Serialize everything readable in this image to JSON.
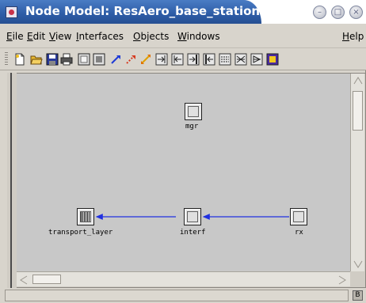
{
  "window": {
    "title": "Node Model: ResAero_base_station",
    "controls": {
      "minimize": "–",
      "maximize": "□",
      "close": "×"
    }
  },
  "menu": {
    "items": [
      {
        "key": "E",
        "rest": "ile"
      },
      {
        "key": "E",
        "rest": "dit"
      },
      {
        "key": "V",
        "rest": "iew"
      },
      {
        "key": "I",
        "rest": "nterfaces"
      },
      {
        "key": "O",
        "rest": "bjects"
      },
      {
        "key": "W",
        "rest": "indows"
      },
      {
        "key": "H",
        "rest": "elp"
      }
    ]
  },
  "toolbar": {
    "icons": [
      "new-file-icon",
      "open-folder-icon",
      "save-icon",
      "print-icon",
      "create-processor-icon",
      "create-queue-icon",
      "create-packet-stream-icon",
      "create-statistic-wire-icon",
      "create-logical-association-icon",
      "create-point-to-point-tx-icon",
      "create-point-to-point-rx-icon",
      "create-bus-tx-icon",
      "create-bus-rx-icon",
      "create-radio-tx-icon",
      "create-radio-rx-icon",
      "create-antenna-icon",
      "create-external-system-icon"
    ],
    "colors": {
      "stream": "#1f3bd6",
      "statwire": "#d63a1f",
      "assoc": "#e0a000",
      "node_ext": "#4a2aa0"
    }
  },
  "canvas": {
    "background": "#c8c8c8",
    "link_color": "#2030e0",
    "nodes": [
      {
        "id": "mgr",
        "label": "mgr",
        "kind": "processor"
      },
      {
        "id": "transport_layer",
        "label": "transport_layer",
        "kind": "queue"
      },
      {
        "id": "interf",
        "label": "interf",
        "kind": "processor"
      },
      {
        "id": "rx",
        "label": "rx",
        "kind": "processor"
      }
    ]
  },
  "status": {
    "text": "",
    "icon": "status-log-icon",
    "icon_glyph": "B"
  }
}
